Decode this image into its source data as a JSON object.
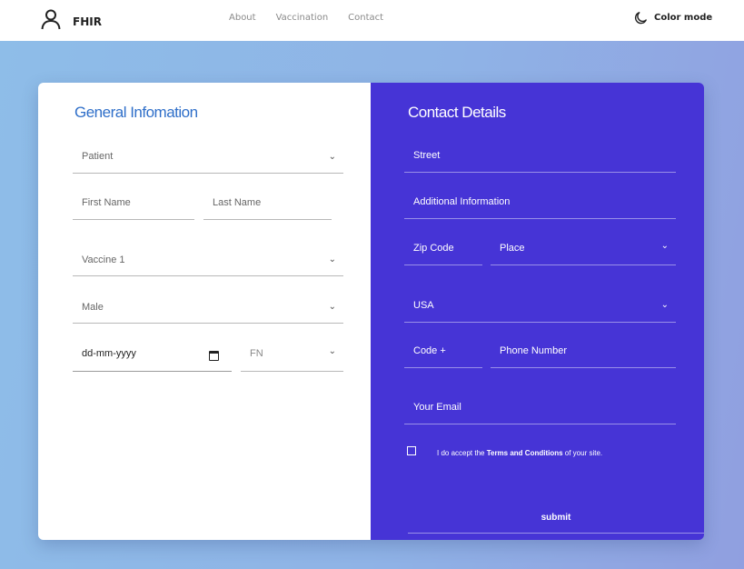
{
  "navbar": {
    "brand": "FHIR",
    "links": [
      "About",
      "Vaccination",
      "Contact"
    ],
    "color_mode": "Color mode"
  },
  "general": {
    "title": "General Infomation",
    "patient_select": "Patient",
    "first_name_placeholder": "First Name",
    "last_name_placeholder": "Last Name",
    "vaccine_select": "Vaccine 1",
    "gender_select": "Male",
    "date_placeholder": "dd-mm-yyyy",
    "fn_select": "FN"
  },
  "contact": {
    "title": "Contact Details",
    "street_placeholder": "Street",
    "additional_placeholder": "Additional Information",
    "zip_placeholder": "Zip Code",
    "place_select": "Place",
    "country_select": "USA",
    "code_placeholder": "Code +",
    "phone_placeholder": "Phone Number",
    "email_placeholder": "Your Email",
    "terms_prefix": "I do accept the ",
    "terms_link": "Terms and Conditions",
    "terms_suffix": " of your site.",
    "submit": "submit"
  },
  "icons": {
    "brand": "user-icon",
    "color_mode": "moon-icon",
    "chevron": "chevron-down-icon",
    "calendar": "calendar-icon"
  },
  "colors": {
    "accent_blue": "#2f6fc9",
    "right_panel": "#4634d6",
    "background_gradient_start": "#8ebde8",
    "background_gradient_end": "#909fe0"
  }
}
